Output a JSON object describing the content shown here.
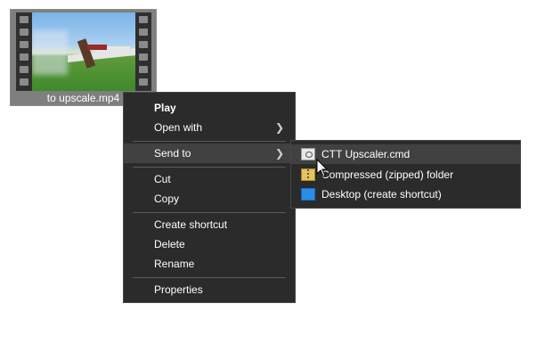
{
  "file": {
    "name": "to upscale.mp4",
    "thumbnail_icon": "video-thumbnail-icon"
  },
  "context_menu": {
    "items": [
      {
        "label": "Play",
        "bold": true
      },
      {
        "label": "Open with",
        "submenu": true
      },
      {
        "label": "Send to",
        "submenu": true,
        "highlighted": true
      },
      {
        "label": "Cut"
      },
      {
        "label": "Copy"
      },
      {
        "label": "Create shortcut"
      },
      {
        "label": "Delete"
      },
      {
        "label": "Rename"
      },
      {
        "label": "Properties"
      }
    ]
  },
  "send_to_menu": {
    "items": [
      {
        "label": "CTT Upscaler.cmd",
        "icon": "cmd-file-icon",
        "highlighted": true
      },
      {
        "label": "Compressed (zipped) folder",
        "icon": "zip-folder-icon"
      },
      {
        "label": "Desktop (create shortcut)",
        "icon": "desktop-icon"
      }
    ]
  },
  "colors": {
    "menu_bg": "#2b2b2b",
    "menu_highlight": "#414141",
    "menu_text": "#ffffff",
    "file_selection": "#7f7f7f"
  }
}
